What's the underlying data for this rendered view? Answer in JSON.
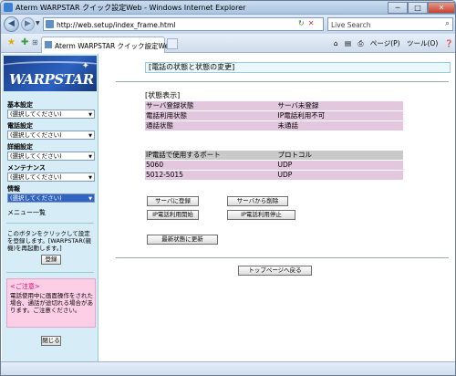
{
  "window": {
    "title": "Aterm WARPSTAR クイック設定Web - Windows Internet Explorer",
    "minimize": "─",
    "maximize": "□",
    "close": "✕"
  },
  "browser": {
    "url": "http://web.setup/index_frame.html",
    "search_placeholder": "Live Search",
    "tab_title": "Aterm WARPSTAR クイック設定Web",
    "page_menu": "ページ(P)",
    "tools_menu": "ツール(O)",
    "help_icon": "❓"
  },
  "sidebar": {
    "logo_text": "WARPSTAR",
    "groups": [
      {
        "label": "基本設定",
        "value": "(選択してください)"
      },
      {
        "label": "電話設定",
        "value": "(選択してください)"
      },
      {
        "label": "詳細設定",
        "value": "(選択してください)"
      },
      {
        "label": "メンテナンス",
        "value": "(選択してください)"
      },
      {
        "label": "情報",
        "value": "(選択してください)"
      }
    ],
    "menu_list": "メニュー一覧",
    "note": "このボタンをクリックして設定を登録します。[WARPSTAR(親機)を再起動します。]",
    "save_button": "登録",
    "caution_title": "<ご注意>",
    "caution_body": "電話使用中に画面操作をされた場合、通話が途切れる場合があります。ご注意ください。",
    "close_button": "閉じる"
  },
  "main": {
    "title": "[電話の状態と状態の変更]",
    "status_section": "[状態表示]",
    "status_rows": [
      {
        "label": "サーバ登録状態",
        "value": "サーバ未登録"
      },
      {
        "label": "電話利用状態",
        "value": "IP電話利用不可"
      },
      {
        "label": "通話状態",
        "value": "未通話"
      }
    ],
    "port_header": {
      "label": "IP電話で使用するポート",
      "value": "プロトコル"
    },
    "port_rows": [
      {
        "label": "5060",
        "value": "UDP"
      },
      {
        "label": "5012-5015",
        "value": "UDP"
      }
    ],
    "buttons": {
      "register": "サーバに登録",
      "unregister": "サーバから削除",
      "start": "IP電話利用開始",
      "stop": "IP電話利用停止",
      "refresh": "最新状態に更新",
      "top": "トップページへ戻る"
    }
  }
}
